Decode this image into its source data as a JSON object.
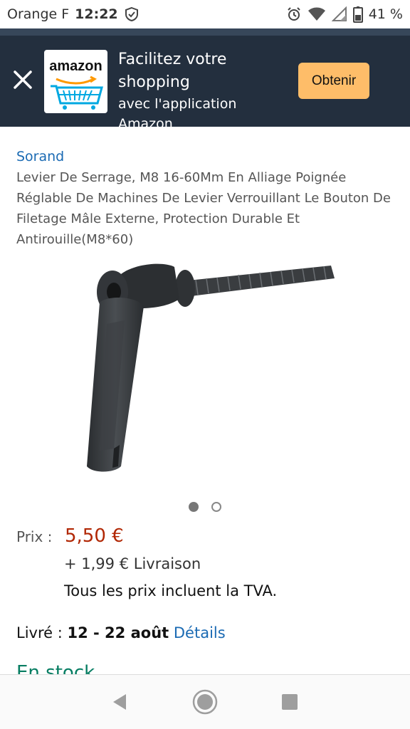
{
  "status_bar": {
    "carrier": "Orange F",
    "time": "12:22",
    "battery": "41 %"
  },
  "banner": {
    "logo_text": "amazon",
    "line1": "Facilitez votre",
    "line2": "shopping",
    "line3": "avec l'application Amazon",
    "button_label": "Obtenir"
  },
  "product": {
    "brand": "Sorand",
    "title": "Levier De Serrage, M8 16-60Mm En Alliage Poignée Réglable De Machines De Levier Verrouillant Le Bouton De Filetage Mâle Externe, Protection Durable Et Antirouille(M8*60)",
    "image_count": 2,
    "active_image": 1
  },
  "pricing": {
    "label": "Prix :",
    "price": "5,50 €",
    "shipping": "+ 1,99 € Livraison",
    "tax_note": "Tous les prix incluent la TVA."
  },
  "delivery": {
    "label": "Livré :",
    "dates": "12 - 22 août",
    "details_link": "Détails"
  },
  "stock": {
    "text": "En stock"
  },
  "colors": {
    "banner_bg": "#232f3e",
    "button_bg": "#febd69",
    "link": "#1a6ab3",
    "price": "#b12704",
    "stock": "#067d62"
  }
}
